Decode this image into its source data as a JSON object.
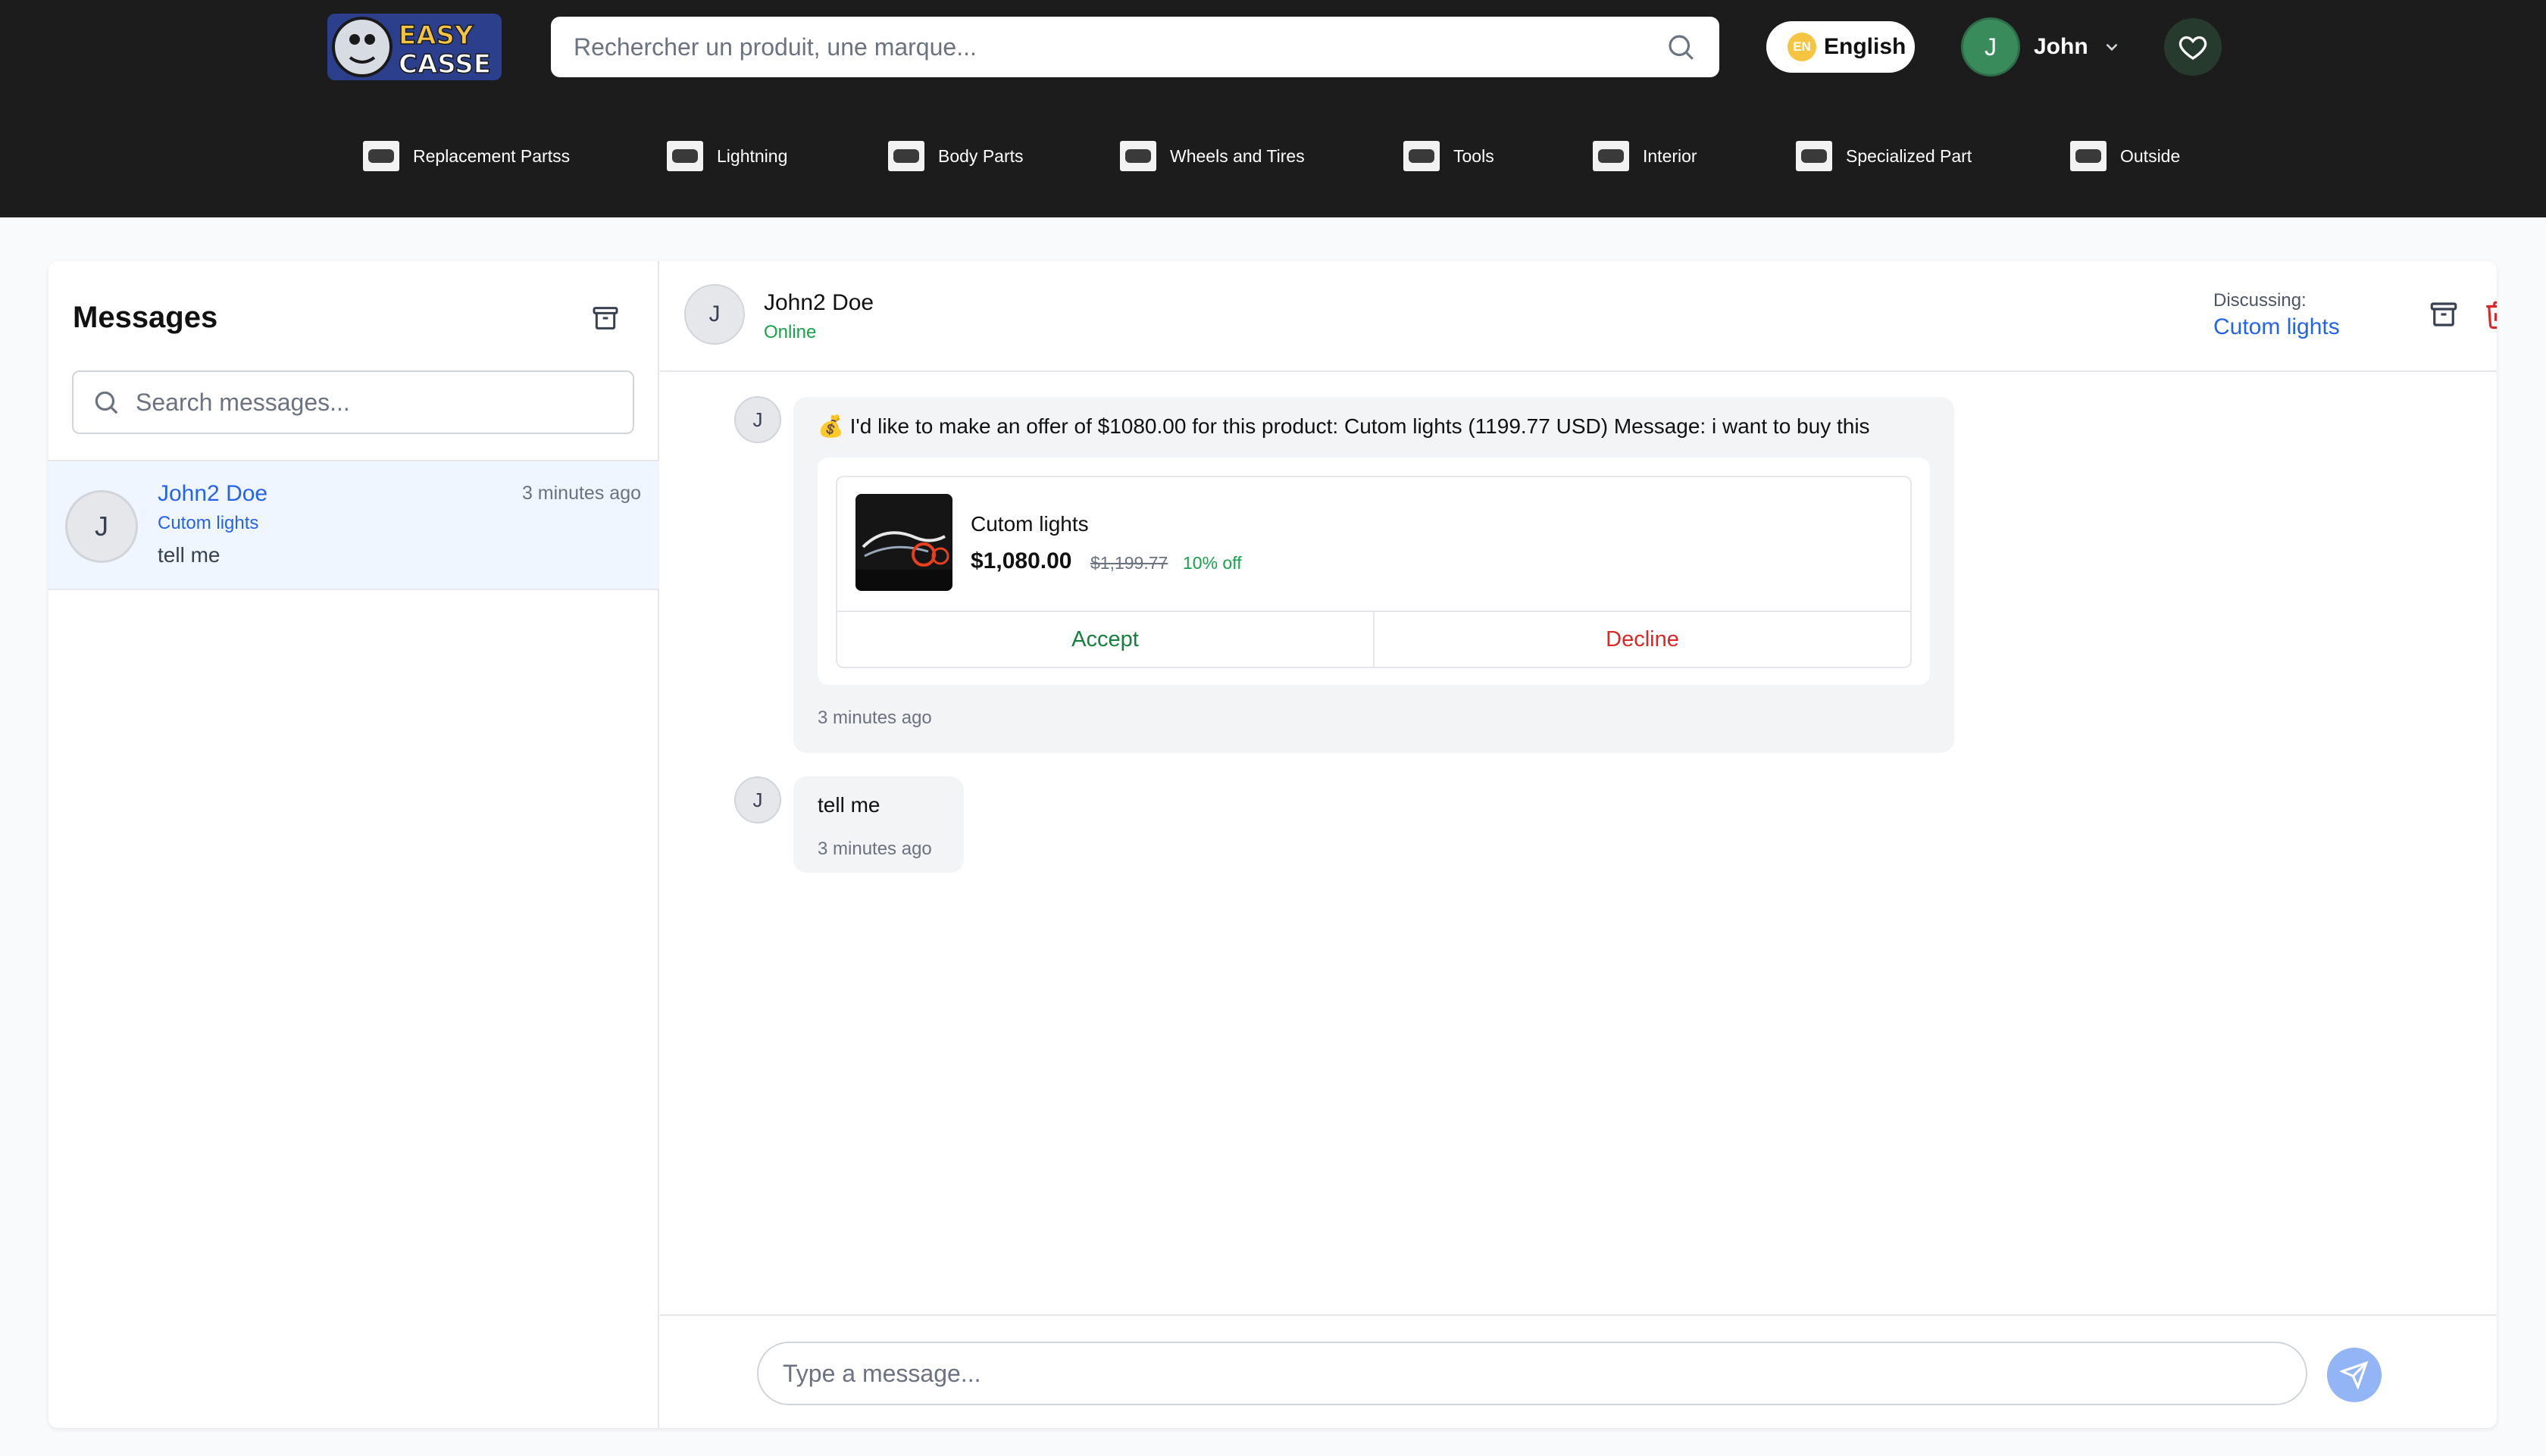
{
  "header": {
    "logo_text": "EASY CASSE",
    "search_placeholder": "Rechercher un produit, une marque...",
    "language_code": "EN",
    "language_label": "English",
    "user_initial": "J",
    "user_name": "John"
  },
  "categories": [
    {
      "label": "Replacement Partss",
      "icon": "car-part-icon"
    },
    {
      "label": "Lightning",
      "icon": "headlight-icon"
    },
    {
      "label": "Body Parts",
      "icon": "body-part-icon"
    },
    {
      "label": "Wheels and Tires",
      "icon": "wheel-icon"
    },
    {
      "label": "Tools",
      "icon": "tool-icon"
    },
    {
      "label": "Interior",
      "icon": "interior-icon"
    },
    {
      "label": "Specialized Part",
      "icon": "specialized-part-icon"
    },
    {
      "label": "Outside",
      "icon": "exterior-icon"
    }
  ],
  "sidebar": {
    "title": "Messages",
    "search_placeholder": "Search messages...",
    "conversations": [
      {
        "initial": "J",
        "name": "John2 Doe",
        "time": "3 minutes ago",
        "product": "Cutom lights",
        "last_message": "tell me"
      }
    ]
  },
  "chat": {
    "contact_initial": "J",
    "contact_name": "John2 Doe",
    "contact_status": "Online",
    "discussing_label": "Discussing:",
    "discussing_product": "Cutom lights",
    "messages": [
      {
        "initial": "J",
        "text": "💰 I'd like to make an offer of $1080.00 for this product: Cutom lights (1199.77 USD) Message: i want to buy this",
        "offer": {
          "product": "Cutom lights",
          "price": "$1,080.00",
          "original_price": "$1,199.77",
          "discount": "10% off",
          "accept_label": "Accept",
          "decline_label": "Decline"
        },
        "time": "3 minutes ago"
      },
      {
        "initial": "J",
        "text": "tell me",
        "time": "3 minutes ago"
      }
    ],
    "composer_placeholder": "Type a message..."
  },
  "colors": {
    "header_bg": "#1c1c1c",
    "accent_blue": "#2563eb",
    "online_green": "#16a34a",
    "accept_green": "#15803d",
    "decline_red": "#dc2626",
    "avatar_green": "#3a8b5c"
  }
}
